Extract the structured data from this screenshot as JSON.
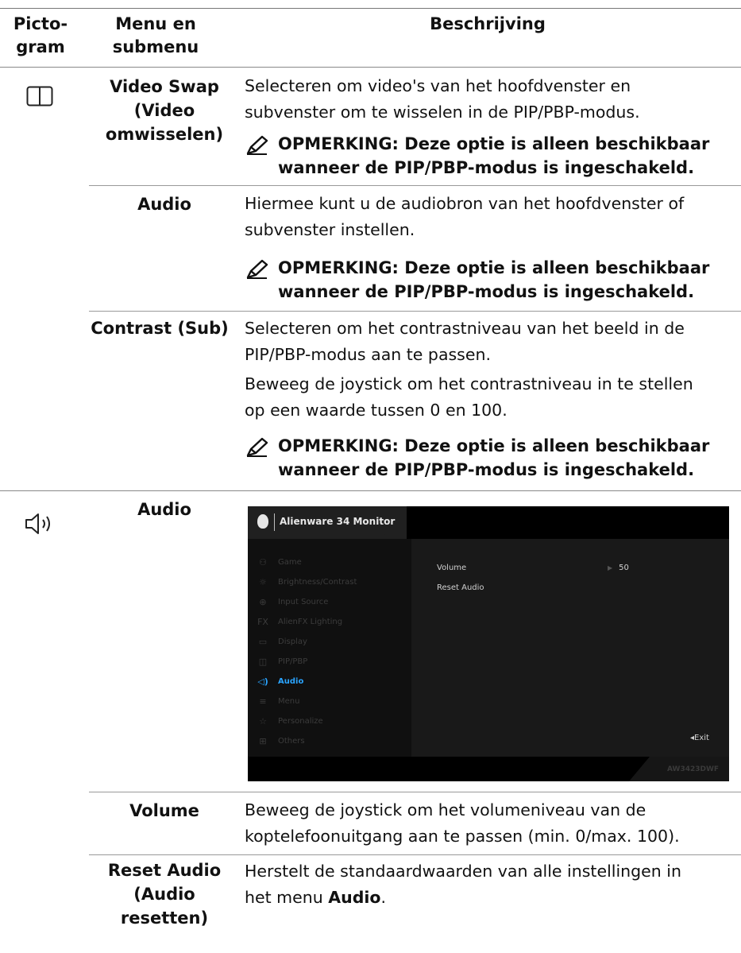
{
  "header": {
    "col1": [
      "Picto-",
      "gram"
    ],
    "col2": [
      "Menu en",
      "submenu"
    ],
    "col3": "Beschrijving"
  },
  "rows": {
    "video_swap": {
      "menu": [
        "Video Swap",
        "(Video",
        "omwisselen)"
      ],
      "desc": [
        "Selecteren om video's van het hoofdvenster en",
        "subvenster om te wisselen in de PIP/PBP-modus."
      ],
      "note": [
        "OPMERKING: Deze optie is alleen beschikbaar",
        "wanneer de PIP/PBP-modus is ingeschakeld."
      ]
    },
    "audio_source": {
      "menu": "Audio",
      "desc": [
        "Hiermee kunt u de audiobron van het hoofdvenster of",
        "subvenster instellen."
      ],
      "note": [
        "OPMERKING: Deze optie is alleen beschikbaar",
        "wanneer de PIP/PBP-modus is ingeschakeld."
      ]
    },
    "contrast_sub": {
      "menu": "Contrast (Sub)",
      "desc": [
        "Selecteren om het contrastniveau van het beeld in de",
        "PIP/PBP-modus aan te passen."
      ],
      "desc2": [
        "Beweeg de joystick om het contrastniveau in te stellen",
        "op een waarde tussen 0 en 100."
      ],
      "note": [
        "OPMERKING: Deze optie is alleen beschikbaar",
        "wanneer de PIP/PBP-modus is ingeschakeld."
      ]
    },
    "audio": {
      "menu": "Audio"
    },
    "volume": {
      "menu": "Volume",
      "desc": [
        "Beweeg de joystick om het volumeniveau van de",
        "koptelefoonuitgang aan te passen (min. 0/max. 100)."
      ]
    },
    "reset_audio": {
      "menu": [
        "Reset Audio",
        "(Audio",
        "resetten)"
      ],
      "desc_line1": "Herstelt de standaardwaarden van alle instellingen in",
      "desc_line2_pre": "het menu ",
      "desc_line2_bold": "Audio",
      "desc_line2_post": "."
    }
  },
  "icons": {
    "pip": "pip-icon",
    "audio": "speaker-icon",
    "note": "pencil-note-icon"
  },
  "osd": {
    "monitor_name": "Alienware 34 Monitor",
    "menu_items": [
      {
        "icon": "gamepad-icon",
        "glyph": "⚇",
        "label": "Game"
      },
      {
        "icon": "brightness-icon",
        "glyph": "☼",
        "label": "Brightness/Contrast"
      },
      {
        "icon": "input-source-icon",
        "glyph": "⊕",
        "label": "Input Source"
      },
      {
        "icon": "fx-icon",
        "glyph": "FX",
        "label": "AlienFX Lighting"
      },
      {
        "icon": "display-icon",
        "glyph": "▭",
        "label": "Display"
      },
      {
        "icon": "pip-icon",
        "glyph": "◫",
        "label": "PIP/PBP"
      },
      {
        "icon": "speaker-icon",
        "glyph": "◁)",
        "label": "Audio"
      },
      {
        "icon": "menu-icon",
        "glyph": "≡",
        "label": "Menu"
      },
      {
        "icon": "star-icon",
        "glyph": "☆",
        "label": "Personalize"
      },
      {
        "icon": "others-icon",
        "glyph": "⊞",
        "label": "Others"
      }
    ],
    "active_index": 6,
    "sub_items": [
      "Volume",
      "Reset Audio"
    ],
    "volume_value": "50",
    "exit_label": "◂Exit",
    "model": "AW3423DWF",
    "active_color": "#2aa4ff"
  }
}
